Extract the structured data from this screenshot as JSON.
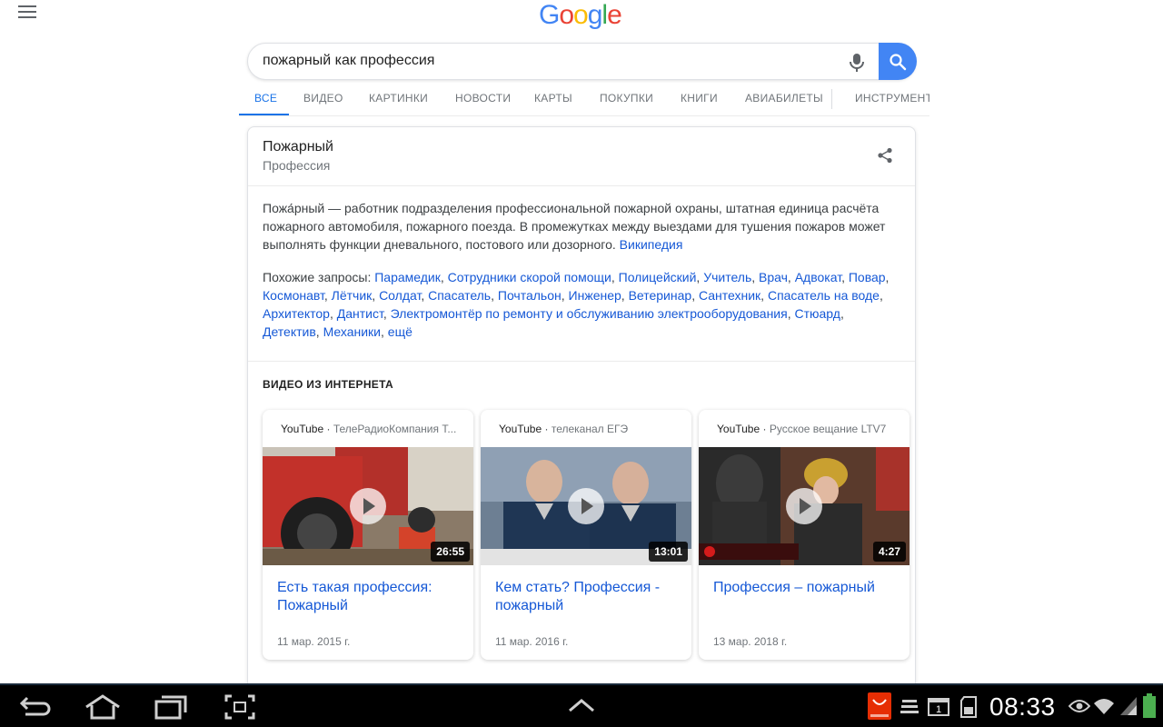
{
  "logo": {
    "text": "Google",
    "letters": [
      {
        "ch": "G",
        "color": "#4285f4"
      },
      {
        "ch": "o",
        "color": "#ea4335"
      },
      {
        "ch": "o",
        "color": "#fbbc05"
      },
      {
        "ch": "g",
        "color": "#4285f4"
      },
      {
        "ch": "l",
        "color": "#34a853"
      },
      {
        "ch": "e",
        "color": "#ea4335"
      }
    ]
  },
  "search": {
    "query": "пожарный как профессия",
    "mic_icon": "microphone-icon",
    "search_icon": "search-icon"
  },
  "tabs": [
    {
      "label": "ВСЕ",
      "active": true
    },
    {
      "label": "ВИДЕО"
    },
    {
      "label": "КАРТИНКИ"
    },
    {
      "label": "НОВОСТИ"
    },
    {
      "label": "КАРТЫ"
    },
    {
      "label": "ПОКУПКИ"
    },
    {
      "label": "КНИГИ"
    },
    {
      "label": "АВИАБИЛЕТЫ"
    },
    {
      "label": "ИНСТРУМЕНТЫ"
    }
  ],
  "panel": {
    "title": "Пожарный",
    "subtitle": "Профессия",
    "share_icon": "share-icon",
    "description": "Пожа́рный — работник подразделения профессиональной пожарной охраны, штатная единица расчёта пожарного автомобиля, пожарного поезда. В промежутках между выездами для тушения пожаров может выполнять функции дневального, постового или дозорного.",
    "source_link": "Википедия",
    "related_label": "Похожие запросы:",
    "related": [
      "Парамедик",
      "Сотрудники скорой помощи",
      "Полицейский",
      "Учитель",
      "Врач",
      "Адвокат",
      "Повар",
      "Космонавт",
      "Лётчик",
      "Солдат",
      "Спасатель",
      "Почтальон",
      "Инженер",
      "Ветеринар",
      "Сантехник",
      "Спасатель на воде",
      "Архитектор",
      "Дантист",
      "Электромонтёр по ремонту и обслуживанию электрооборудования",
      "Стюард",
      "Детектив",
      "Механики",
      "ещё"
    ]
  },
  "videos": {
    "header": "ВИДЕО ИЗ ИНТЕРНЕТА",
    "items": [
      {
        "site": "YouTube",
        "channel": "ТелеРадиоКомпания Т...",
        "duration": "26:55",
        "title": "Есть такая профессия: Пожарный",
        "date": "11 мар. 2015 г."
      },
      {
        "site": "YouTube",
        "channel": "телеканал ЕГЭ",
        "duration": "13:01",
        "title": "Кем стать? Профессия - пожарный",
        "date": "11 мар. 2016 г."
      },
      {
        "site": "YouTube",
        "channel": "Русское вещание LTV7",
        "duration": "4:27",
        "title": "Профессия – пожарный",
        "date": "13 мар. 2018 г."
      }
    ]
  },
  "statusbar": {
    "time": "08:33",
    "notification_count": "1",
    "colors": {
      "bar": "#000000",
      "battery": "#4caf50",
      "aliexpress": "#e62e04"
    },
    "icons": [
      "back-icon",
      "home-icon",
      "recent-apps-icon",
      "screenshot-icon",
      "up-chevron-icon",
      "aliexpress-icon",
      "notification-icon",
      "calendar-icon",
      "sd-card-icon",
      "eye-icon",
      "wifi-icon",
      "signal-icon",
      "battery-icon"
    ]
  }
}
